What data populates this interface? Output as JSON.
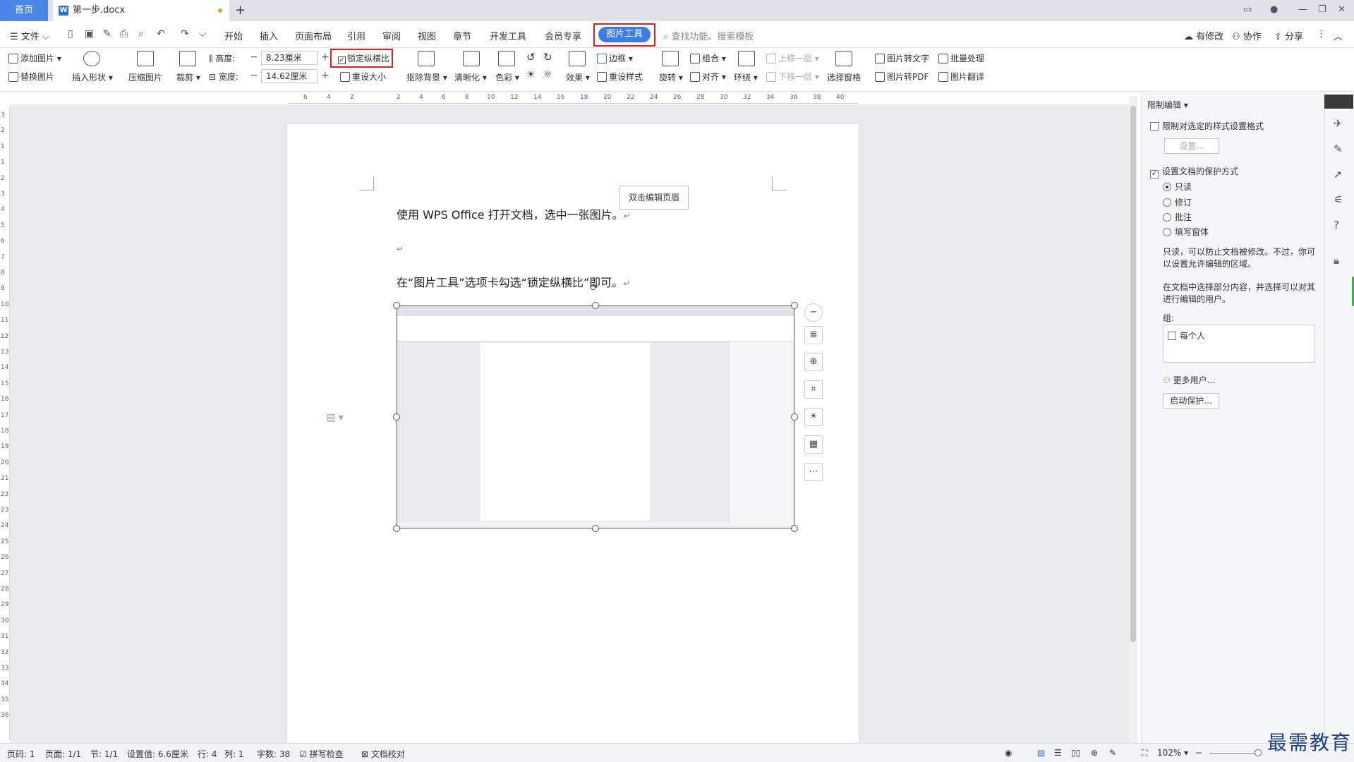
{
  "tabbar": {
    "home": "首页",
    "doc_name": "第一步.docx",
    "new_tab": "+"
  },
  "menu": {
    "file": "文件",
    "items": [
      "开始",
      "插入",
      "页面布局",
      "引用",
      "审阅",
      "视图",
      "章节",
      "开发工具",
      "会员专享"
    ],
    "active": "图片工具",
    "search": "查找功能、搜索模板",
    "right": [
      "有修改",
      "协作",
      "分享"
    ]
  },
  "ribbon": {
    "add_image": "添加图片",
    "replace_image": "替换图片",
    "insert_shape": "插入形状",
    "compress": "压缩图片",
    "crop": "裁剪",
    "height_label": "高度:",
    "height_value": "8.23厘米",
    "width_label": "宽度:",
    "width_value": "14.62厘米",
    "lock_ratio": "锁定纵横比",
    "reset_size": "重设大小",
    "remove_bg": "抠除背景",
    "sharpen": "清晰化",
    "color": "色彩",
    "effect": "效果",
    "border": "边框",
    "reset_style": "重设样式",
    "rotate": "旋转",
    "group": "组合",
    "align": "对齐",
    "wrap": "环绕",
    "bring_forward": "上移一层",
    "send_backward": "下移一层",
    "selection_pane": "选择窗格",
    "to_text": "图片转文字",
    "batch": "批量处理",
    "to_pdf": "图片转PDF",
    "translate": "图片翻译"
  },
  "ruler": {
    "h_ticks": [
      "6",
      "4",
      "2",
      "2",
      "4",
      "6",
      "8",
      "10",
      "12",
      "14",
      "16",
      "18",
      "20",
      "22",
      "24",
      "26",
      "28",
      "30",
      "32",
      "34",
      "36",
      "38",
      "40"
    ],
    "v_ticks": [
      "3",
      "2",
      "1",
      "1",
      "2",
      "3",
      "4",
      "5",
      "6",
      "7",
      "8",
      "9",
      "10",
      "11",
      "12",
      "13",
      "14",
      "15",
      "16",
      "17",
      "18",
      "19",
      "20",
      "21",
      "22",
      "23",
      "24",
      "25",
      "26",
      "27",
      "28",
      "29",
      "30",
      "31",
      "32",
      "33",
      "34",
      "35",
      "36"
    ]
  },
  "document": {
    "para1": "使用 WPS Office 打开文档，选中一张图片。",
    "para2": "在“图片工具”选项卡勾选“锁定纵横比”即可。",
    "header_tip": "双击编辑页眉",
    "para_mark": "↵"
  },
  "panel": {
    "title": "限制编辑",
    "opt1": "限制对选定的样式设置格式",
    "settings_btn": "设置...",
    "opt2": "设置文档的保护方式",
    "radios": [
      "只读",
      "修订",
      "批注",
      "填写窗体"
    ],
    "selected_radio": "只读",
    "desc1_l1": "只读，可以防止文档被修改。不过，你可",
    "desc1_l2": "以设置允许编辑的区域。",
    "desc2_l1": "在文档中选择部分内容，并选择可以对其",
    "desc2_l2": "进行编辑的用户。",
    "group_label": "组:",
    "everyone": "每个人",
    "more_users": "更多用户...",
    "start_protect": "启动保护..."
  },
  "status": {
    "page_code": "页码: 1",
    "page": "页面: 1/1",
    "section": "节: 1/1",
    "setting": "设置值: 6.6厘米",
    "row": "行: 4",
    "col": "列: 1",
    "words": "字数: 38",
    "spell": "拼写检查",
    "proof": "文档校对",
    "zoom": "102%"
  },
  "watermark": "最需教育"
}
